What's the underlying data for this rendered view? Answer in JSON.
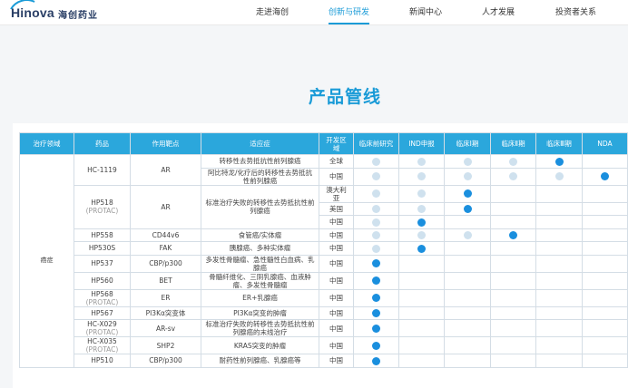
{
  "brand": {
    "name_en": "Hinova",
    "name_cn": "海创药业"
  },
  "nav": {
    "items": [
      {
        "label": "走进海创"
      },
      {
        "label": "创新与研发"
      },
      {
        "label": "新闻中心"
      },
      {
        "label": "人才发展"
      },
      {
        "label": "投资者关系"
      }
    ],
    "active_index": 1
  },
  "page": {
    "title": "产品管线"
  },
  "colors": {
    "accent": "#1a9bd7",
    "header_bg": "#2ba7dc",
    "dot_complete": "#cfe1ee",
    "dot_current": "#1a8fde"
  },
  "table": {
    "headers": [
      "治疗领域",
      "药品",
      "作用靶点",
      "适应症",
      "开发区域",
      "临床前研究",
      "IND申报",
      "临床Ⅰ期",
      "临床Ⅱ期",
      "临床Ⅲ期",
      "NDA"
    ],
    "therapeutic_area": "癌症",
    "drugs": [
      {
        "name": "HC-1119",
        "sub": "",
        "target": "AR",
        "indication": "",
        "rows": [
          {
            "indication": "转移性去势抵抗性前列腺癌",
            "region": "全球",
            "dots": [
              "light",
              "light",
              "light",
              "light",
              "dark",
              ""
            ]
          },
          {
            "indication": "阿比特龙/化疗后的转移性去势抵抗性前列腺癌",
            "region": "中国",
            "dots": [
              "light",
              "light",
              "light",
              "light",
              "light",
              "dark"
            ]
          }
        ]
      },
      {
        "name": "HP518",
        "sub": "(PROTAC)",
        "target": "AR",
        "indication": "标准治疗失败的转移性去势抵抗性前列腺癌",
        "rows": [
          {
            "region": "澳大利亚",
            "dots": [
              "light",
              "light",
              "dark",
              "",
              "",
              ""
            ]
          },
          {
            "region": "美国",
            "dots": [
              "light",
              "light",
              "dark",
              "",
              "",
              ""
            ]
          },
          {
            "region": "中国",
            "dots": [
              "light",
              "dark",
              "",
              "",
              "",
              ""
            ]
          }
        ]
      },
      {
        "name": "HP558",
        "sub": "",
        "target": "CD44v6",
        "indication": "",
        "rows": [
          {
            "indication": "食管癌/实体瘤",
            "region": "中国",
            "dots": [
              "light",
              "light",
              "light",
              "dark",
              "",
              ""
            ]
          }
        ]
      },
      {
        "name": "HP530S",
        "sub": "",
        "target": "FAK",
        "indication": "",
        "rows": [
          {
            "indication": "胰腺癌、多种实体瘤",
            "region": "中国",
            "dots": [
              "light",
              "dark",
              "",
              "",
              "",
              ""
            ]
          }
        ]
      },
      {
        "name": "HP537",
        "sub": "",
        "target": "CBP/p300",
        "indication": "",
        "rows": [
          {
            "indication": "多发性骨髓瘤、急性髓性白血病、乳腺癌",
            "region": "中国",
            "dots": [
              "dark",
              "",
              "",
              "",
              "",
              ""
            ]
          }
        ]
      },
      {
        "name": "HP560",
        "sub": "",
        "target": "BET",
        "indication": "",
        "rows": [
          {
            "indication": "骨髓纤维化、三阴乳腺癌、血液肿瘤、多发性骨髓瘤",
            "region": "中国",
            "dots": [
              "dark",
              "",
              "",
              "",
              "",
              ""
            ]
          }
        ]
      },
      {
        "name": "HP568",
        "sub": "(PROTAC)",
        "target": "ER",
        "indication": "",
        "rows": [
          {
            "indication": "ER+乳腺癌",
            "region": "中国",
            "dots": [
              "dark",
              "",
              "",
              "",
              "",
              ""
            ]
          }
        ]
      },
      {
        "name": "HP567",
        "sub": "",
        "target": "PI3Kα突变体",
        "indication": "",
        "rows": [
          {
            "indication": "PI3Kα突变的肿瘤",
            "region": "中国",
            "dots": [
              "dark",
              "",
              "",
              "",
              "",
              ""
            ]
          }
        ]
      },
      {
        "name": "HC-X029",
        "sub": "(PROTAC)",
        "target": "AR-sv",
        "indication": "",
        "rows": [
          {
            "indication": "标准治疗失败的转移性去势抵抗性前列腺癌的末线治疗",
            "region": "中国",
            "dots": [
              "dark",
              "",
              "",
              "",
              "",
              ""
            ]
          }
        ]
      },
      {
        "name": "HC-X035",
        "sub": "(PROTAC)",
        "target": "SHP2",
        "indication": "",
        "rows": [
          {
            "indication": "KRAS突变的肿瘤",
            "region": "中国",
            "dots": [
              "dark",
              "",
              "",
              "",
              "",
              ""
            ]
          }
        ]
      },
      {
        "name": "HP510",
        "sub": "",
        "target": "CBP/p300",
        "indication": "",
        "rows": [
          {
            "indication": "耐药性前列腺癌、乳腺癌等",
            "region": "中国",
            "dots": [
              "dark",
              "",
              "",
              "",
              "",
              ""
            ]
          }
        ]
      }
    ]
  }
}
